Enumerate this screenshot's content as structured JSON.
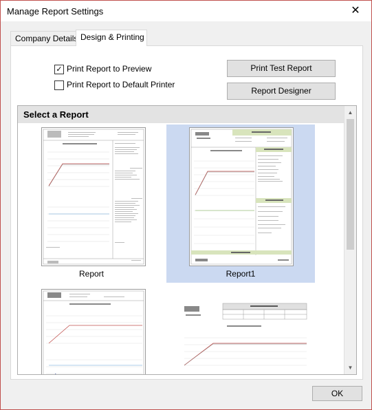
{
  "window": {
    "title": "Manage Report Settings"
  },
  "tabs": [
    {
      "label": "Company Details"
    },
    {
      "label": "Design & Printing"
    }
  ],
  "options": {
    "print_preview": {
      "label": "Print Report to Preview",
      "checked": true
    },
    "print_default": {
      "label": "Print Report to Default Printer",
      "checked": false
    }
  },
  "buttons": {
    "test": "Print Test Report",
    "designer": "Report Designer",
    "ok": "OK"
  },
  "report_list": {
    "header": "Select a Report",
    "items": [
      {
        "name": "Report",
        "selected": false
      },
      {
        "name": "Report1",
        "selected": true
      }
    ]
  },
  "colors": {
    "selection": "#cbd9f1",
    "dialog_bg": "#f0f0f0",
    "border": "#c0504d"
  },
  "icons": {
    "close": "close-icon",
    "checked": "checkmark-icon",
    "scroll_up": "scroll-up-arrow-icon",
    "scroll_down": "scroll-down-arrow-icon"
  }
}
